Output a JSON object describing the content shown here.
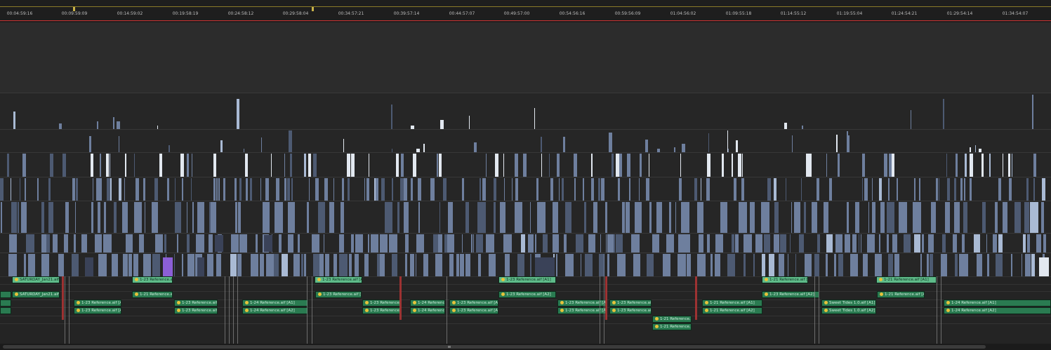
{
  "ruler": {
    "timecodes": [
      "00:04:59:16",
      "00:09:59:09",
      "00:14:59:02",
      "00:19:58:19",
      "00:24:58:12",
      "00:29:58:04",
      "00:34:57:21",
      "00:39:57:14",
      "00:44:57:07",
      "00:49:57:00",
      "00:54:56:16",
      "00:59:56:09",
      "01:04:56:02",
      "01:09:55:18",
      "01:14:55:12",
      "01:19:55:04",
      "01:24:54:21",
      "01:29:54:14",
      "01:34:54:07"
    ]
  },
  "audio_clips": [
    {
      "label": "SATURDAY_Jan21.aif [A1]",
      "light": true
    },
    {
      "label": "1-23 Reference.aif [A1]",
      "light": true
    },
    {
      "label": "1-23 Reference.aif [A1]",
      "light": true
    },
    {
      "label": "1-23 Reference.aif [A1]",
      "light": true
    },
    {
      "label": "1-21 Reference.aif [A1]",
      "light": true
    },
    {
      "label": "1-21 Reference.aif [A1]",
      "light": true
    },
    {
      "label": "SATURDAY_Jan21.aif [A2]",
      "light": false
    },
    {
      "label": "1-23 Reference.aif [A2]",
      "light": false
    },
    {
      "label": "1-23 Reference.aif [A2]",
      "light": false
    },
    {
      "label": "1-23 Reference.aif [A2]",
      "light": false
    },
    {
      "label": "1-21 Reference.aif [A2]",
      "light": false
    },
    {
      "label": "1-21 Reference.aif [A2]",
      "light": false
    },
    {
      "label": "1-23 Reference.aif [A1]",
      "light": false
    },
    {
      "label": "1-23 Reference.aif [A1]",
      "light": false
    },
    {
      "label": "1-24 Reference.aif [A1]",
      "light": false
    },
    {
      "label": "1-23 Reference.aif [A1]",
      "light": false
    },
    {
      "label": "1-24 Reference.aif [A1]",
      "light": false
    },
    {
      "label": "1-23 Reference.aif [A1]",
      "light": false
    },
    {
      "label": "1-23 Reference.aif [A1]",
      "light": false
    },
    {
      "label": "1-23 Reference.aif [A1]",
      "light": false
    },
    {
      "label": "1-21 Reference.aif [A1]",
      "light": false
    },
    {
      "label": "Sweet Tides 1.0.aif [A1]",
      "light": false
    },
    {
      "label": "1-24 Reference.aif [A1]",
      "light": false
    },
    {
      "label": "1-23 Reference.aif [A2]",
      "light": false
    },
    {
      "label": "1-23 Reference.aif [A2]",
      "light": false
    },
    {
      "label": "1-24 Reference.aif [A2]",
      "light": false
    },
    {
      "label": "1-23 Reference.aif [A2]",
      "light": false
    },
    {
      "label": "1-24 Reference.aif [A2]",
      "light": false
    },
    {
      "label": "1-23 Reference.aif [A2]",
      "light": false
    },
    {
      "label": "1-23 Reference.aif [A2]",
      "light": false
    },
    {
      "label": "1-23 Reference.aif [A2]",
      "light": false
    },
    {
      "label": "1-21 Reference.aif [A2]",
      "light": false
    },
    {
      "label": "Sweet Tides 1.0.aif [A2]",
      "light": false
    },
    {
      "label": "1-24 Reference.aif [A2]",
      "light": false
    },
    {
      "label": "1-21 Reference.aif [A1]",
      "light": false
    },
    {
      "label": "1-21 Reference.aif [A2]",
      "light": false
    }
  ]
}
